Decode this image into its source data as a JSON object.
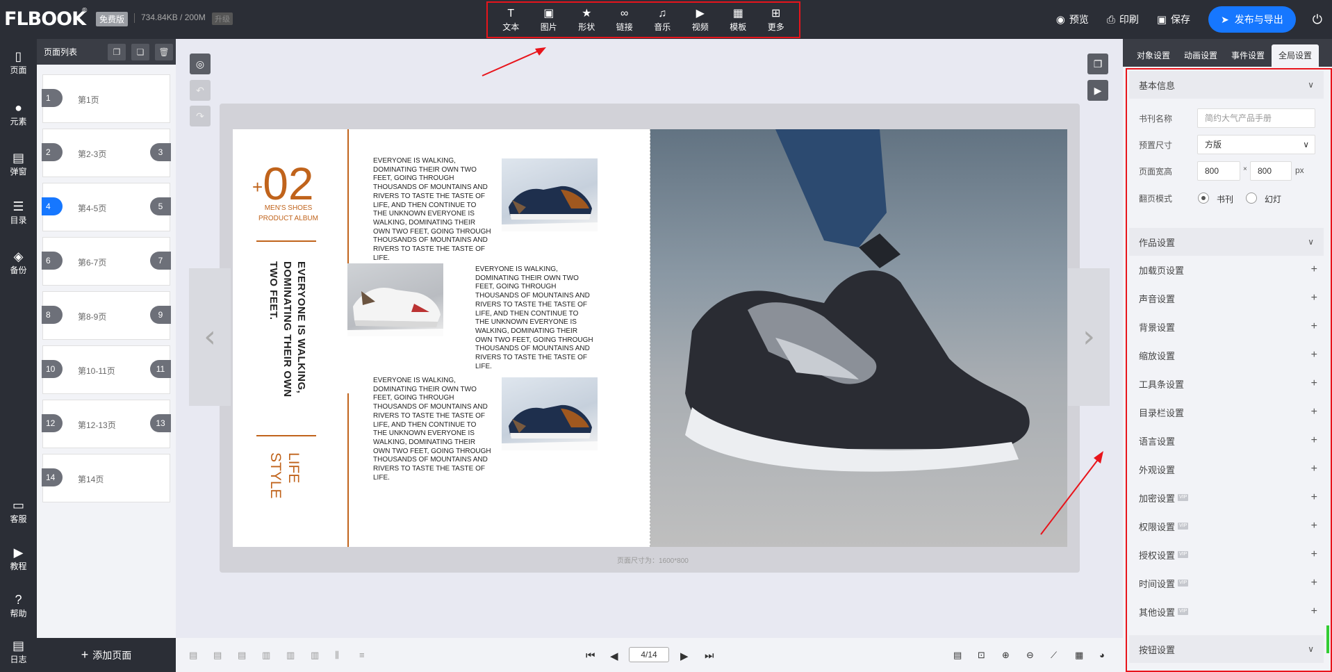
{
  "app": {
    "logo_text": "FLBOOK",
    "logo_reg": "®",
    "plan_badge": "免费版",
    "storage": "734.84KB / 200M",
    "upgrade_badge": "升级"
  },
  "toolbar": [
    {
      "label": "文本",
      "icon": "text-icon",
      "glyph": "T"
    },
    {
      "label": "图片",
      "icon": "image-icon",
      "glyph": "▣"
    },
    {
      "label": "形状",
      "icon": "star-icon",
      "glyph": "★"
    },
    {
      "label": "链接",
      "icon": "link-icon",
      "glyph": "∞"
    },
    {
      "label": "音乐",
      "icon": "music-icon",
      "glyph": "♫"
    },
    {
      "label": "视频",
      "icon": "video-icon",
      "glyph": "▶"
    },
    {
      "label": "模板",
      "icon": "template-icon",
      "glyph": "▦"
    },
    {
      "label": "更多",
      "icon": "more-icon",
      "glyph": "⊞"
    }
  ],
  "top_actions": {
    "preview": "预览",
    "print": "印刷",
    "save": "保存",
    "publish": "发布与导出"
  },
  "leftnav": [
    {
      "label": "页面",
      "icon": "page-icon",
      "glyph": "▯"
    },
    {
      "label": "元素",
      "icon": "elements-icon",
      "glyph": "●"
    },
    {
      "label": "弹窗",
      "icon": "popup-icon",
      "glyph": "▤"
    },
    {
      "label": "目录",
      "icon": "catalog-icon",
      "glyph": "☰"
    },
    {
      "label": "备份",
      "icon": "backup-icon",
      "glyph": "◈"
    },
    {
      "label": "客服",
      "icon": "support-icon",
      "glyph": "▭"
    },
    {
      "label": "教程",
      "icon": "tutorial-icon",
      "glyph": "▶"
    },
    {
      "label": "帮助",
      "icon": "help-icon",
      "glyph": "?"
    },
    {
      "label": "日志",
      "icon": "log-icon",
      "glyph": "▤"
    }
  ],
  "page_panel": {
    "title": "页面列表",
    "add_page": "添加页面",
    "pages": [
      {
        "left": "1",
        "right": "",
        "label": "第1页",
        "active": false
      },
      {
        "left": "2",
        "right": "3",
        "label": "第2-3页",
        "active": false
      },
      {
        "left": "4",
        "right": "5",
        "label": "第4-5页",
        "active": true
      },
      {
        "left": "6",
        "right": "7",
        "label": "第6-7页",
        "active": false
      },
      {
        "left": "8",
        "right": "9",
        "label": "第8-9页",
        "active": false
      },
      {
        "left": "10",
        "right": "11",
        "label": "第10-11页",
        "active": false
      },
      {
        "left": "12",
        "right": "13",
        "label": "第12-13页",
        "active": false
      },
      {
        "left": "14",
        "right": "",
        "label": "第14页",
        "active": false
      }
    ]
  },
  "canvas": {
    "page_size_label": "页面尺寸为：1600*800",
    "num": "02",
    "plus": "+",
    "album_line1": "MEN'S SHOES",
    "album_line2": "PRODUCT ALBUM",
    "vertical_title": "EVERYONE IS WALKING, DOMINATING THEIR OWN TWO FEET.",
    "life_style": "LIFE STYLE",
    "paragraph": "EVERYONE IS WALKING, DOMINATING THEIR OWN TWO FEET, GOING THROUGH THOUSANDS OF MOUNTAINS AND RIVERS TO TASTE THE TASTE OF LIFE, AND THEN CONTINUE TO THE UNKNOWN EVERYONE IS WALKING, DOMINATING THEIR OWN TWO FEET, GOING THROUGH THOUSANDS OF MOUNTAINS AND RIVERS TO TASTE THE TASTE OF LIFE."
  },
  "pager": {
    "current": "4/14"
  },
  "right_panel": {
    "tabs": [
      "对象设置",
      "动画设置",
      "事件设置",
      "全局设置"
    ],
    "active_tab": 3,
    "basic": {
      "title": "基本信息",
      "book_name_label": "书刊名称",
      "book_name_placeholder": "简约大气产品手册",
      "preset_label": "预置尺寸",
      "preset_value": "方版",
      "size_label": "页面宽高",
      "width": "800",
      "height": "800",
      "x": "×",
      "unit": "px",
      "flip_label": "翻页模式",
      "flip_book": "书刊",
      "flip_slide": "幻灯"
    },
    "work_title": "作品设置",
    "settings": [
      {
        "label": "加载页设置",
        "vip": ""
      },
      {
        "label": "声音设置",
        "vip": ""
      },
      {
        "label": "背景设置",
        "vip": ""
      },
      {
        "label": "缩放设置",
        "vip": ""
      },
      {
        "label": "工具条设置",
        "vip": ""
      },
      {
        "label": "目录栏设置",
        "vip": ""
      },
      {
        "label": "语言设置",
        "vip": ""
      },
      {
        "label": "外观设置",
        "vip": ""
      },
      {
        "label": "加密设置",
        "vip": "VIP"
      },
      {
        "label": "权限设置",
        "vip": "VIP"
      },
      {
        "label": "授权设置",
        "vip": "VIP"
      },
      {
        "label": "时间设置",
        "vip": "VIP"
      },
      {
        "label": "其他设置",
        "vip": "VIP"
      }
    ],
    "button_title": "按钮设置"
  },
  "colors": {
    "accent": "#1677ff",
    "highlight": "#e8141b",
    "brand_orange": "#c0631b",
    "dark": "#2b2e36"
  }
}
